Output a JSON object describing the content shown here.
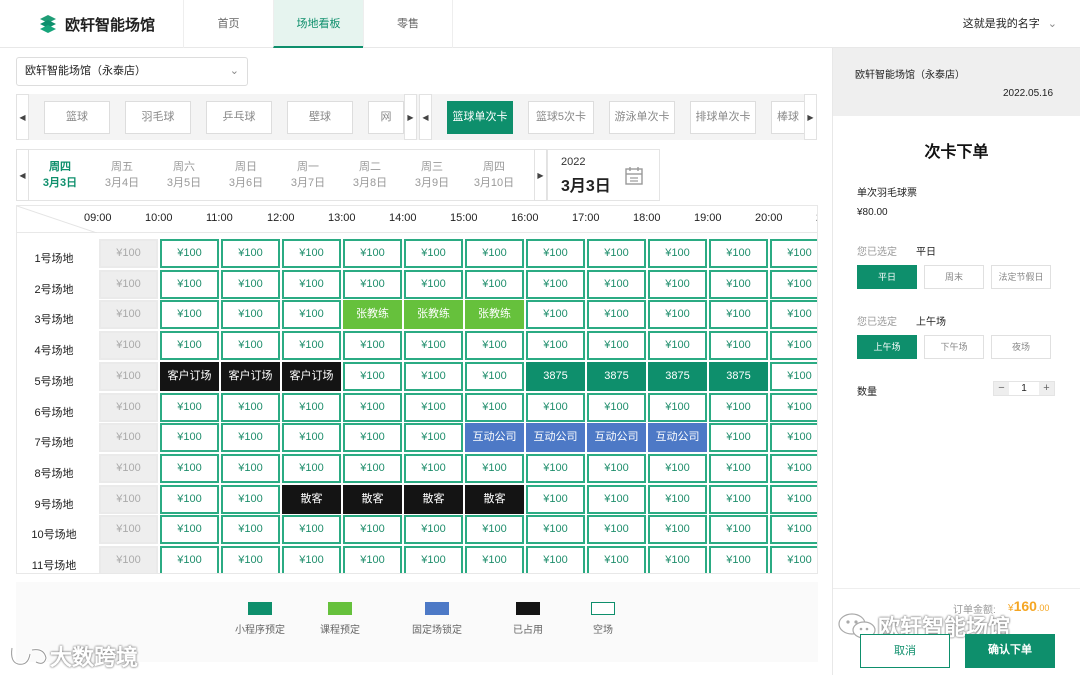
{
  "app": {
    "name": "欧轩智能场馆",
    "user": "这就是我的名字"
  },
  "nav": {
    "tabs": [
      "首页",
      "场地看板",
      "零售"
    ]
  },
  "venue": {
    "selected": "欧轩智能场馆（永泰店）"
  },
  "sports": [
    "篮球",
    "羽毛球",
    "乒乓球",
    "壁球",
    "网"
  ],
  "cards": [
    "篮球单次卡",
    "篮球5次卡",
    "游泳单次卡",
    "排球单次卡",
    "棒球"
  ],
  "dates": [
    {
      "weekday": "周四",
      "date": "3月3日"
    },
    {
      "weekday": "周五",
      "date": "3月4日"
    },
    {
      "weekday": "周六",
      "date": "3月5日"
    },
    {
      "weekday": "周日",
      "date": "3月6日"
    },
    {
      "weekday": "周一",
      "date": "3月7日"
    },
    {
      "weekday": "周二",
      "date": "3月8日"
    },
    {
      "weekday": "周三",
      "date": "3月9日"
    },
    {
      "weekday": "周四",
      "date": "3月10日"
    }
  ],
  "current_date": {
    "year": "2022",
    "day": "3月3日"
  },
  "times": [
    "09:00",
    "10:00",
    "11:00",
    "12:00",
    "13:00",
    "14:00",
    "15:00",
    "16:00",
    "17:00",
    "18:00",
    "19:00",
    "20:00",
    "2"
  ],
  "courts": [
    "1号场地",
    "2号场地",
    "3号场地",
    "4号场地",
    "5号场地",
    "6号场地",
    "7号场地",
    "8号场地",
    "9号场地",
    "10号场地",
    "11号场地"
  ],
  "price_label": "¥100",
  "bookings": {
    "course": "张教练",
    "occupied_5": "客户订场",
    "miniprogram": "3875",
    "fixed": "互动公司",
    "occupied_9": "散客"
  },
  "legend": [
    "小程序预定",
    "课程预定",
    "固定场锁定",
    "已占用",
    "空场"
  ],
  "colors": {
    "miniprogram": "#0e8f6c",
    "course": "#66c13c",
    "fixed": "#4d79c6",
    "occupied": "#141414",
    "empty": "#ffffff",
    "accent": "#0e8f6c",
    "price": "#f5a623"
  },
  "panel": {
    "venue": "欧轩智能场馆（永泰店）",
    "date": "2022.05.16",
    "title": "次卡下单",
    "product": "单次羽毛球票",
    "price": "¥80.00",
    "selected_label": "您已选定",
    "day_type": "平日",
    "day_options": [
      "平日",
      "周末",
      "法定节假日"
    ],
    "period": "上午场",
    "period_options": [
      "上午场",
      "下午场",
      "夜场"
    ],
    "qty_label": "数量",
    "qty": "1",
    "total_label": "订单金额:",
    "total_currency": "¥",
    "total_int": "160",
    "total_dec": ".00",
    "cancel": "取消",
    "confirm": "确认下单"
  },
  "watermarks": {
    "left": "大数跨境",
    "right": "欧轩智能场馆"
  }
}
